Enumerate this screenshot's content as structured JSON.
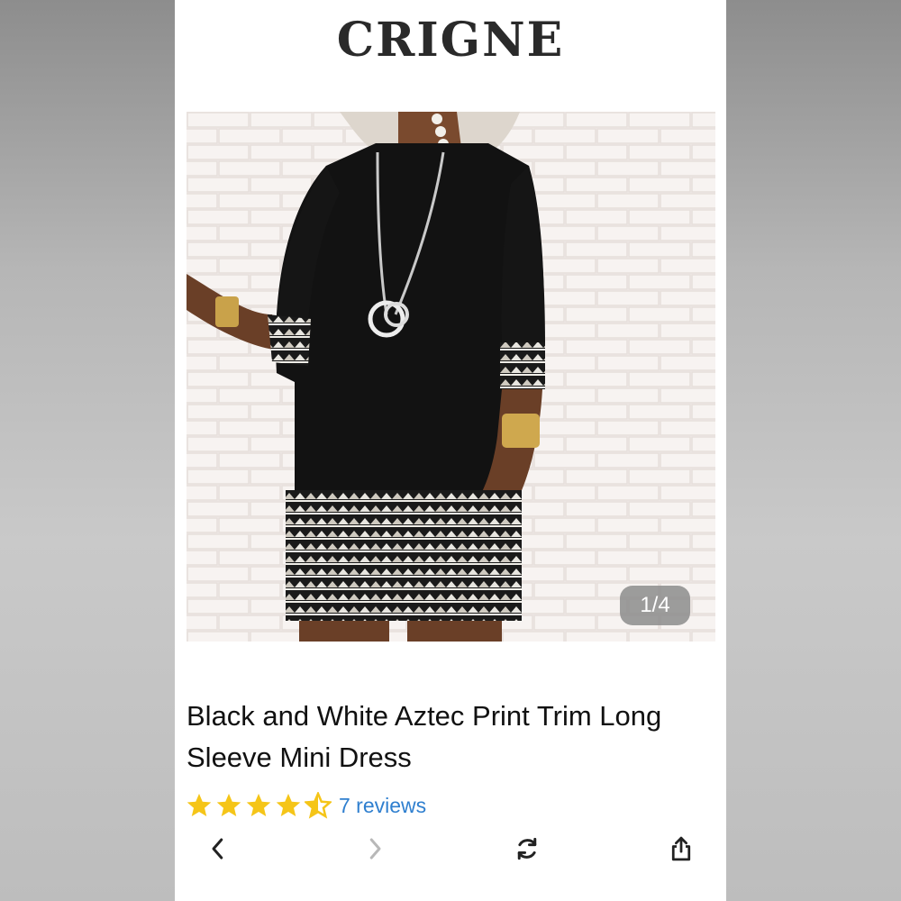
{
  "brand": {
    "name": "CRIGNE"
  },
  "gallery": {
    "indicator": "1/4"
  },
  "product": {
    "title": "Black and White Aztec Print Trim Long Sleeve Mini Dress",
    "rating_value": 4.5,
    "reviews_label": "7 reviews"
  },
  "toolbar": {
    "icons": [
      "back-chevron-icon",
      "forward-chevron-icon",
      "refresh-icon",
      "share-icon"
    ]
  },
  "colors": {
    "star": "#f5c518",
    "link": "#2f7fcf",
    "dress": "#111111",
    "indicator_bg": "#8c8c8c"
  }
}
